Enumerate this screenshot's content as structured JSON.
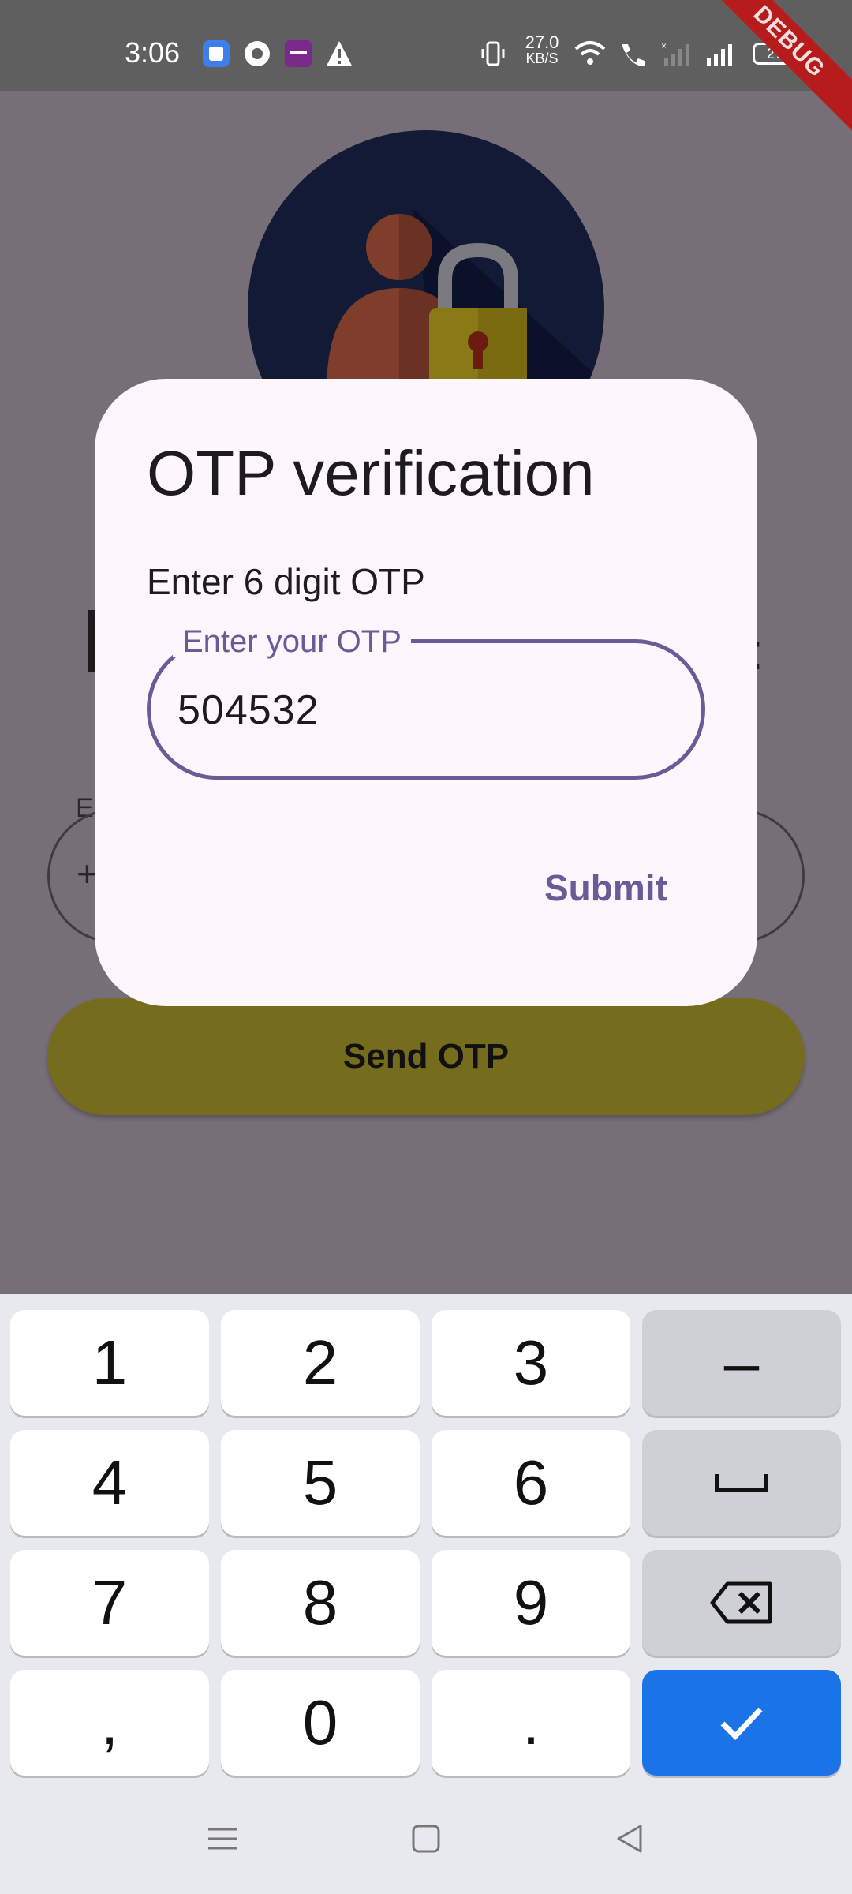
{
  "status_bar": {
    "time": "3:06",
    "net_speed_value": "27.0",
    "net_speed_unit": "KB/S",
    "battery": "27",
    "debug_label": "DEBUG"
  },
  "background": {
    "phone_label": "E",
    "phone_prefix": "+",
    "send_otp_label": "Send OTP"
  },
  "dialog": {
    "title": "OTP verification",
    "subtitle": "Enter 6 digit OTP",
    "otp_label": "Enter your OTP",
    "otp_value": "504532",
    "submit_label": "Submit"
  },
  "keyboard": {
    "keys": [
      "1",
      "2",
      "3",
      "4",
      "5",
      "6",
      "7",
      "8",
      "9",
      ",",
      "0",
      "."
    ],
    "minus": "–"
  },
  "colors": {
    "accent": "#6a5a95",
    "send_button": "#766c1e",
    "enter_key": "#1b73e8",
    "debug_banner": "#b71c1c"
  }
}
